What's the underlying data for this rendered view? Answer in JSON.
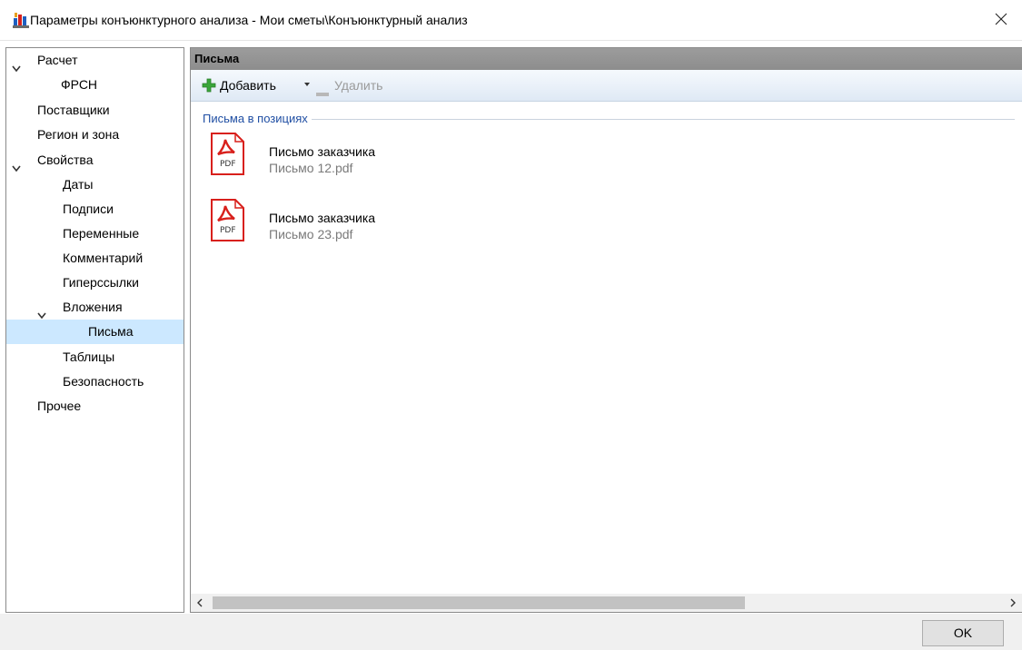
{
  "window": {
    "title": "Параметры конъюнктурного анализа - Мои сметы\\Конъюнктурный анализ"
  },
  "sidebar": {
    "items": [
      {
        "label": "Расчет",
        "expanded": true
      },
      {
        "label": "ФРСН"
      },
      {
        "label": "Поставщики"
      },
      {
        "label": "Регион и зона"
      },
      {
        "label": "Свойства",
        "expanded": true
      },
      {
        "label": "Даты"
      },
      {
        "label": "Подписи"
      },
      {
        "label": "Переменные"
      },
      {
        "label": "Комментарий"
      },
      {
        "label": "Гиперссылки"
      },
      {
        "label": "Вложения",
        "expanded": true
      },
      {
        "label": "Письма",
        "selected": true
      },
      {
        "label": "Таблицы"
      },
      {
        "label": "Безопасность"
      },
      {
        "label": "Прочее"
      }
    ]
  },
  "main": {
    "header": "Письма",
    "toolbar": {
      "add_label": "Добавить",
      "delete_label": "Удалить"
    },
    "group_label": "Письма в позициях",
    "files": [
      {
        "title": "Письмо заказчика",
        "name": "Письмо 12.pdf",
        "icon": "pdf-icon",
        "icon_text": "PDF"
      },
      {
        "title": "Письмо заказчика",
        "name": "Письмо 23.pdf",
        "icon": "pdf-icon",
        "icon_text": "PDF"
      }
    ]
  },
  "footer": {
    "ok_label": "OK"
  },
  "colors": {
    "selection": "#cce8ff",
    "group_label": "#1f4ea3",
    "pdf_red": "#d8201c",
    "add_green": "#3aa63a"
  }
}
